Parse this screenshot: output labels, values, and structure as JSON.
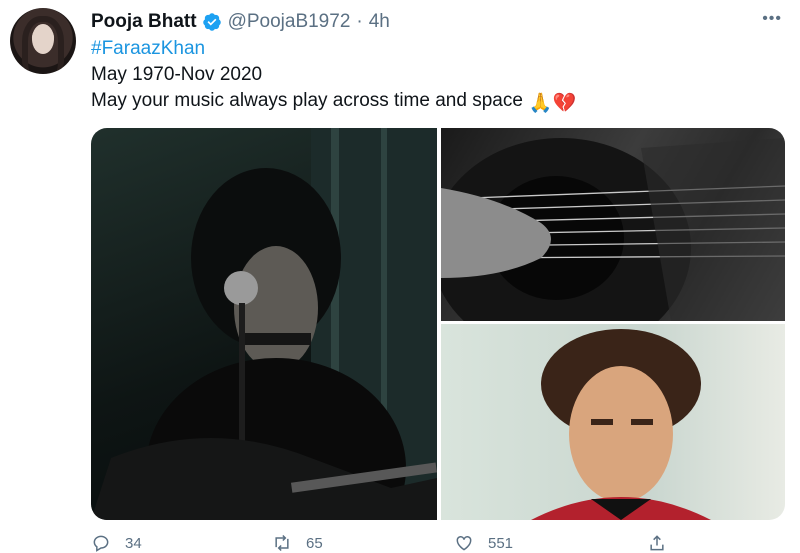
{
  "tweet": {
    "display_name": "Pooja Bhatt",
    "handle": "@PoojaB1972",
    "separator": "·",
    "time": "4h",
    "hashtag": "#FaraazKhan",
    "line1": "May 1970-Nov 2020",
    "line2": "May your music always play across time and space",
    "emojis": "🙏💔",
    "more": "•••"
  },
  "actions": {
    "reply_count": "34",
    "retweet_count": "65",
    "like_count": "551"
  },
  "colors": {
    "accent": "#1b95e0",
    "secondary_text": "#5b7083",
    "verified": "#1da1f2"
  },
  "icons": {
    "verified": "verified-badge-icon",
    "reply": "reply-icon",
    "retweet": "retweet-icon",
    "like": "heart-icon",
    "share": "share-icon",
    "more": "more-icon"
  }
}
